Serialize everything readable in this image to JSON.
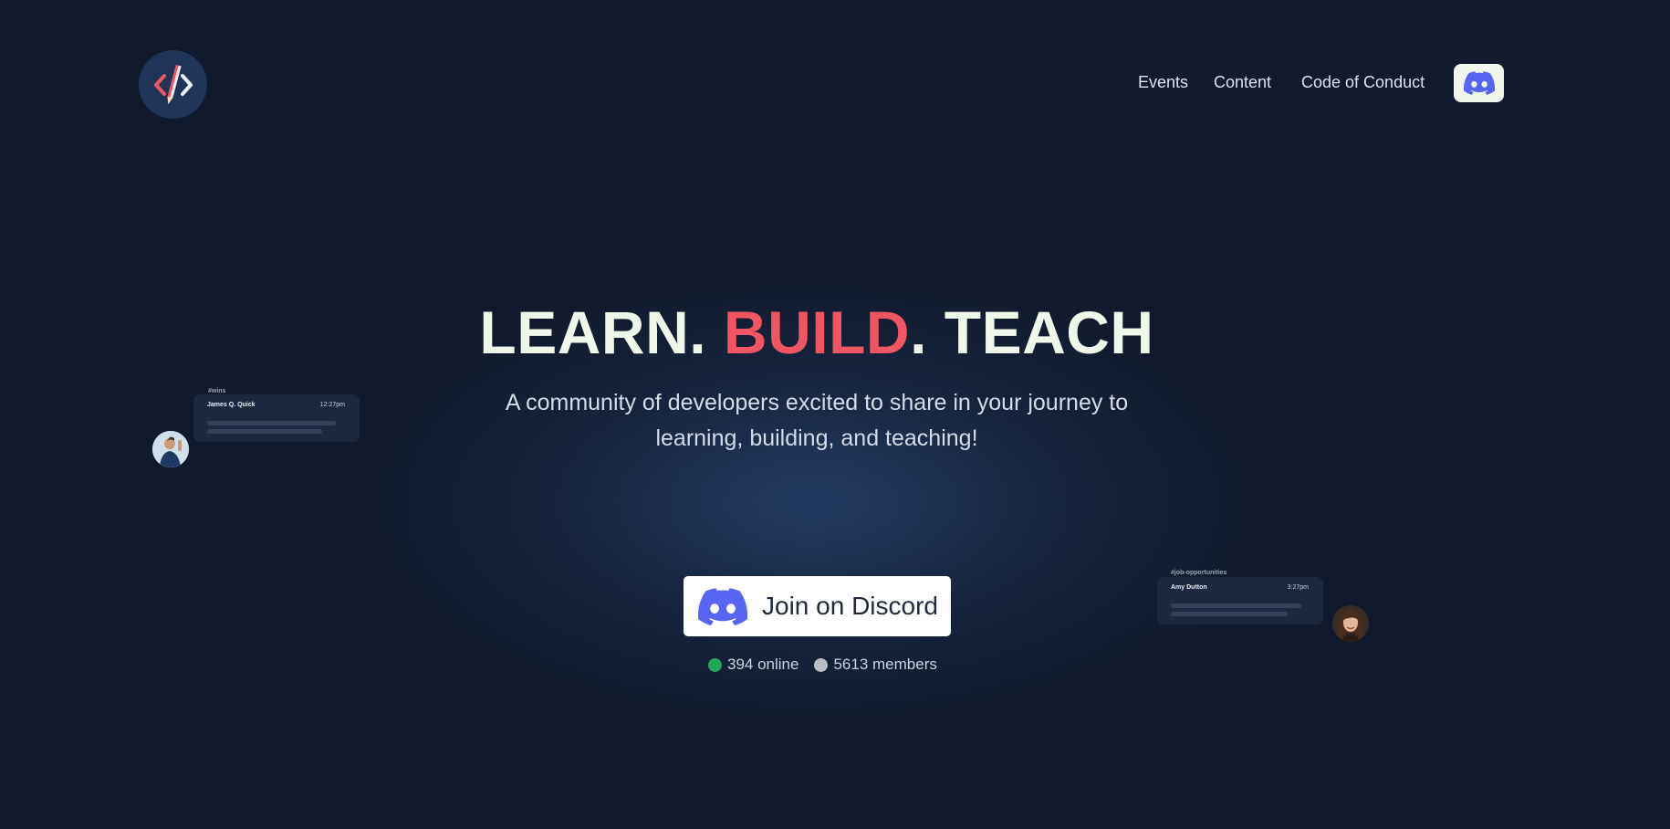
{
  "header": {
    "logo_icon": "code-pencil-logo-icon",
    "nav": [
      {
        "label": "Events"
      },
      {
        "label": "Content"
      },
      {
        "label": "Code of Conduct"
      }
    ],
    "discord_icon": "discord-icon"
  },
  "hero": {
    "headline": {
      "part1": "LEARN. ",
      "accent": "BUILD",
      "part2": ". TEACH"
    },
    "subtitle": "A community of developers excited to share in your journey to learning, building, and teaching!",
    "join_button": {
      "label": "Join on Discord",
      "icon": "discord-icon"
    },
    "stats": {
      "online": "394 online",
      "members": "5613 members"
    }
  },
  "chat_cards": [
    {
      "channel": "#wins",
      "name": "James Q. Quick",
      "time": "12:27pm"
    },
    {
      "channel": "#job-opportunities",
      "name": "Amy Dutton",
      "time": "3:27pm"
    }
  ],
  "colors": {
    "background": "#111a2c",
    "accent": "#f05563",
    "headline": "#eff6ea",
    "discord": "#5865f2",
    "online": "#23a55a",
    "offline": "#b9bdc4"
  }
}
